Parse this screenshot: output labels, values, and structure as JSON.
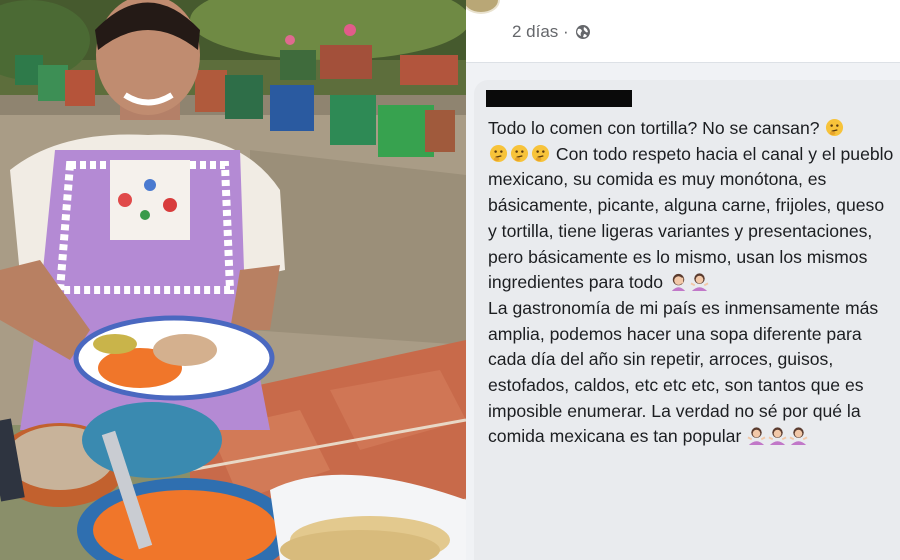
{
  "post": {
    "time_label": "2 días ·",
    "privacy_icon": "globe-icon"
  },
  "comment": {
    "author_redacted": true,
    "line1": "Todo lo comen con tortilla? No se cansan?",
    "para1": "Con todo respeto hacia el canal y el pueblo mexicano, su comida es muy monótona, es básicamente, picante, alguna carne, frijoles, queso y tortilla, tiene ligeras variantes y presentaciones, pero básicamente es lo mismo, usan los mismos ingredientes para todo",
    "para2": "La gastronomía de mi país es inmensamente más amplia, podemos hacer una sopa diferente para cada día del año sin repetir, arroces, guisos, estofados, caldos, etc etc etc, son tantos que es imposible enumerar. La verdad no sé por qué la comida mexicana es tan popular",
    "emoji": {
      "thinking": "thinking-face-icon",
      "facepalm": "woman-facepalming-icon",
      "shrug": "woman-shrugging-icon"
    }
  },
  "colors": {
    "apron": "#b48ad4",
    "tile": "#c86a4a",
    "rice": "#f0762a",
    "fb_bg": "#e9ebee"
  }
}
